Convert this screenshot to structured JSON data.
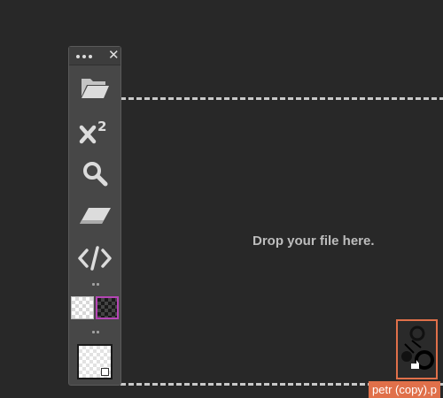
{
  "dropzone": {
    "message": "Drop your file here."
  },
  "toolbar": {
    "close_glyph": "✕",
    "tools": [
      {
        "icon": "folder-open-icon"
      },
      {
        "icon": "superscript-icon"
      },
      {
        "icon": "search-icon"
      },
      {
        "icon": "eraser-icon"
      },
      {
        "icon": "code-icon"
      }
    ],
    "swatches": [
      {
        "name": "light-transparent",
        "color": "#ffffff"
      },
      {
        "name": "dark-transparent",
        "color": "#1a1a1a",
        "selected": true
      }
    ]
  },
  "drag": {
    "file_label": "petr (copy).p",
    "accent": "#e0704a"
  },
  "colors": {
    "background": "#282828",
    "panel": "#474747",
    "dashed_border": "#c9c9c9",
    "selected_swatch_border": "#b545b5"
  }
}
